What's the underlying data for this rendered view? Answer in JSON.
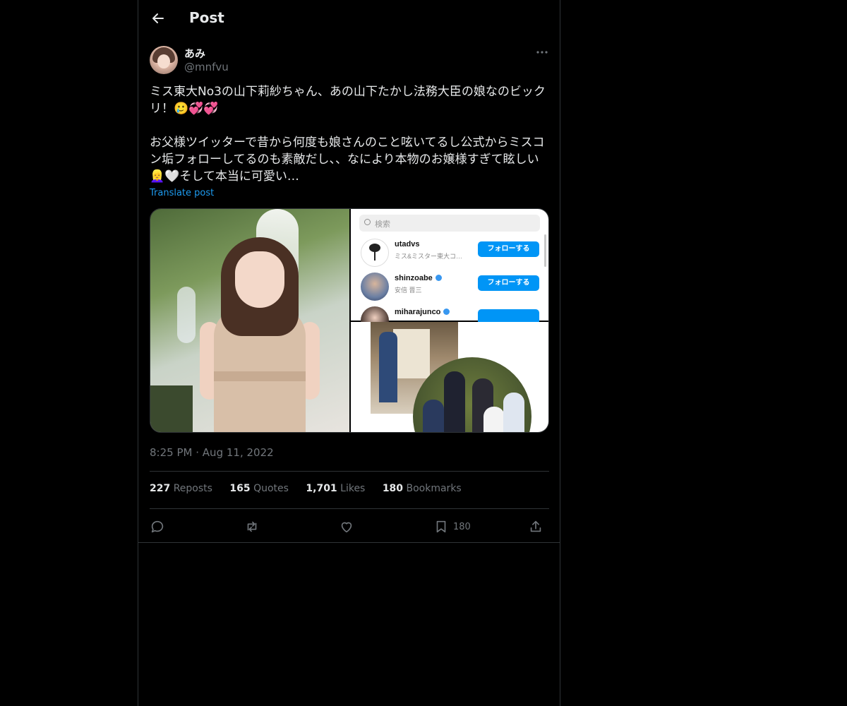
{
  "header": {
    "title": "Post",
    "back_icon": "arrow-left-icon"
  },
  "author": {
    "display_name": "あみ",
    "handle": "@mnfvu"
  },
  "post": {
    "paragraph_1": "ミス東大No3の山下莉紗ちゃん、あの山下たかし法務大臣の娘なのビックリ！🥲💞💞",
    "paragraph_2": "お父様ツイッターで昔から何度も娘さんのこと呟いてるし公式からミスコン垢フォローしてるのも素敵だし、、なにより本物のお嬢様すぎて眩しい👱‍♀️🤍そして本当に可愛い…",
    "translate_label": "Translate post",
    "timestamp_time": "8:25 PM",
    "timestamp_sep": "·",
    "timestamp_date": "Aug 11, 2022"
  },
  "media": {
    "search_placeholder": "検索",
    "accounts": [
      {
        "username": "utadvs",
        "subtitle": "ミス&ミスター東大コ…",
        "verified": false,
        "button": "フォローする"
      },
      {
        "username": "shinzoabe",
        "subtitle": "安倍 晋三",
        "verified": true,
        "button": "フォローする"
      },
      {
        "username": "miharajunco",
        "subtitle": "",
        "verified": true,
        "button": ""
      }
    ]
  },
  "stats": [
    {
      "count": "227",
      "label": "Reposts"
    },
    {
      "count": "165",
      "label": "Quotes"
    },
    {
      "count": "1,701",
      "label": "Likes"
    },
    {
      "count": "180",
      "label": "Bookmarks"
    }
  ],
  "actions": {
    "reply_icon": "reply-icon",
    "repost_icon": "repost-icon",
    "like_icon": "heart-icon",
    "bookmark_icon": "bookmark-icon",
    "bookmark_count": "180",
    "share_icon": "share-icon"
  },
  "colors": {
    "link": "#1d9bf0",
    "muted": "#71767b",
    "text": "#e7e9ea",
    "border": "#2f3336",
    "follow_button": "#0095f6"
  }
}
